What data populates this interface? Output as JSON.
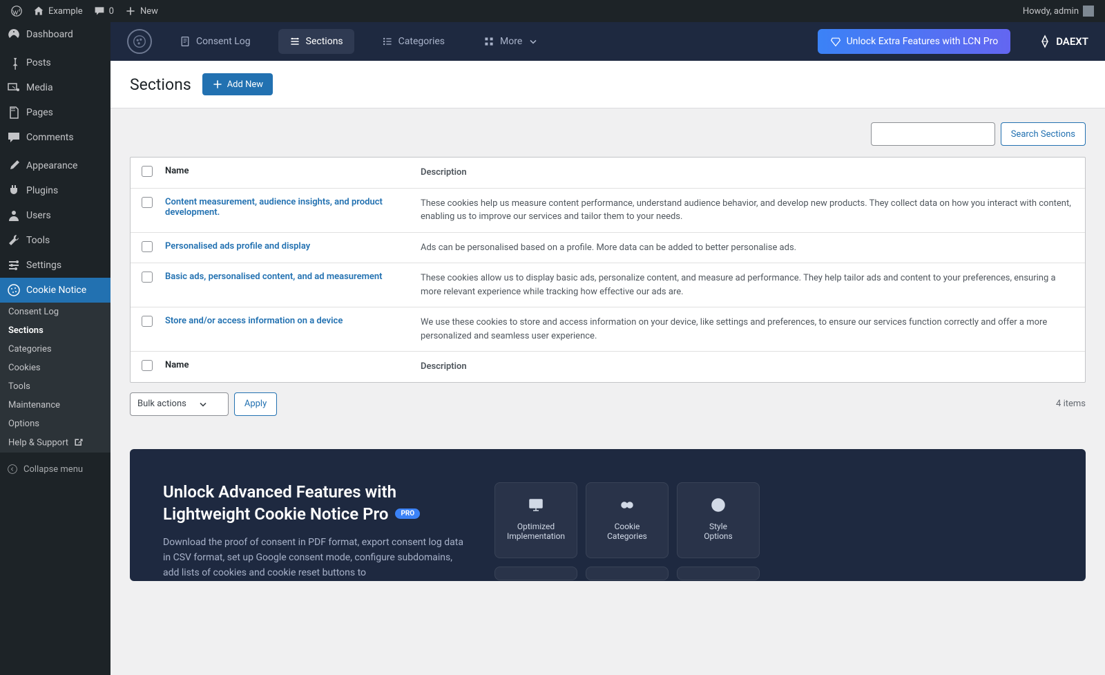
{
  "adminbar": {
    "site_name": "Example",
    "comments": "0",
    "new_label": "New",
    "howdy": "Howdy, admin"
  },
  "sidebar": {
    "items": [
      {
        "label": "Dashboard"
      },
      {
        "label": "Posts"
      },
      {
        "label": "Media"
      },
      {
        "label": "Pages"
      },
      {
        "label": "Comments"
      },
      {
        "label": "Appearance"
      },
      {
        "label": "Plugins"
      },
      {
        "label": "Users"
      },
      {
        "label": "Tools"
      },
      {
        "label": "Settings"
      },
      {
        "label": "Cookie Notice"
      }
    ],
    "submenu": [
      {
        "label": "Consent Log"
      },
      {
        "label": "Sections"
      },
      {
        "label": "Categories"
      },
      {
        "label": "Cookies"
      },
      {
        "label": "Tools"
      },
      {
        "label": "Maintenance"
      },
      {
        "label": "Options"
      },
      {
        "label": "Help & Support"
      }
    ],
    "collapse": "Collapse menu"
  },
  "tabs": {
    "consent_log": "Consent Log",
    "sections": "Sections",
    "categories": "Categories",
    "more": "More",
    "cta": "Unlock Extra Features with LCN Pro",
    "brand": "DAEXT"
  },
  "page": {
    "title": "Sections",
    "add_new": "Add New",
    "search_btn": "Search Sections"
  },
  "table": {
    "col_name": "Name",
    "col_desc": "Description",
    "rows": [
      {
        "name": "Content measurement, audience insights, and product development.",
        "desc": "These cookies help us measure content performance, understand audience behavior, and develop new products. They collect data on how you interact with content, enabling us to improve our services and tailor them to your needs."
      },
      {
        "name": "Personalised ads profile and display",
        "desc": "Ads can be personalised based on a profile. More data can be added to better personalise ads."
      },
      {
        "name": "Basic ads, personalised content, and ad measurement",
        "desc": "These cookies allow us to display basic ads, personalize content, and measure ad performance. They help tailor ads and content to your preferences, ensuring a more relevant experience while tracking how effective our ads are."
      },
      {
        "name": "Store and/or access information on a device",
        "desc": "We use these cookies to store and access information on your device, like settings and preferences, to ensure our services function correctly and offer a more personalized and seamless user experience."
      }
    ]
  },
  "footer": {
    "bulk": "Bulk actions",
    "apply": "Apply",
    "count": "4 items"
  },
  "promo": {
    "title1": "Unlock Advanced Features with",
    "title2": "Lightweight Cookie Notice Pro",
    "badge": "PRO",
    "desc": "Download the proof of consent in PDF format, export consent log data in CSV format, set up Google consent mode, configure subdomains, add lists of cookies and cookie reset buttons to",
    "cards": [
      {
        "l1": "Optimized",
        "l2": "Implementation"
      },
      {
        "l1": "Cookie",
        "l2": "Categories"
      },
      {
        "l1": "Style",
        "l2": "Options"
      }
    ]
  }
}
